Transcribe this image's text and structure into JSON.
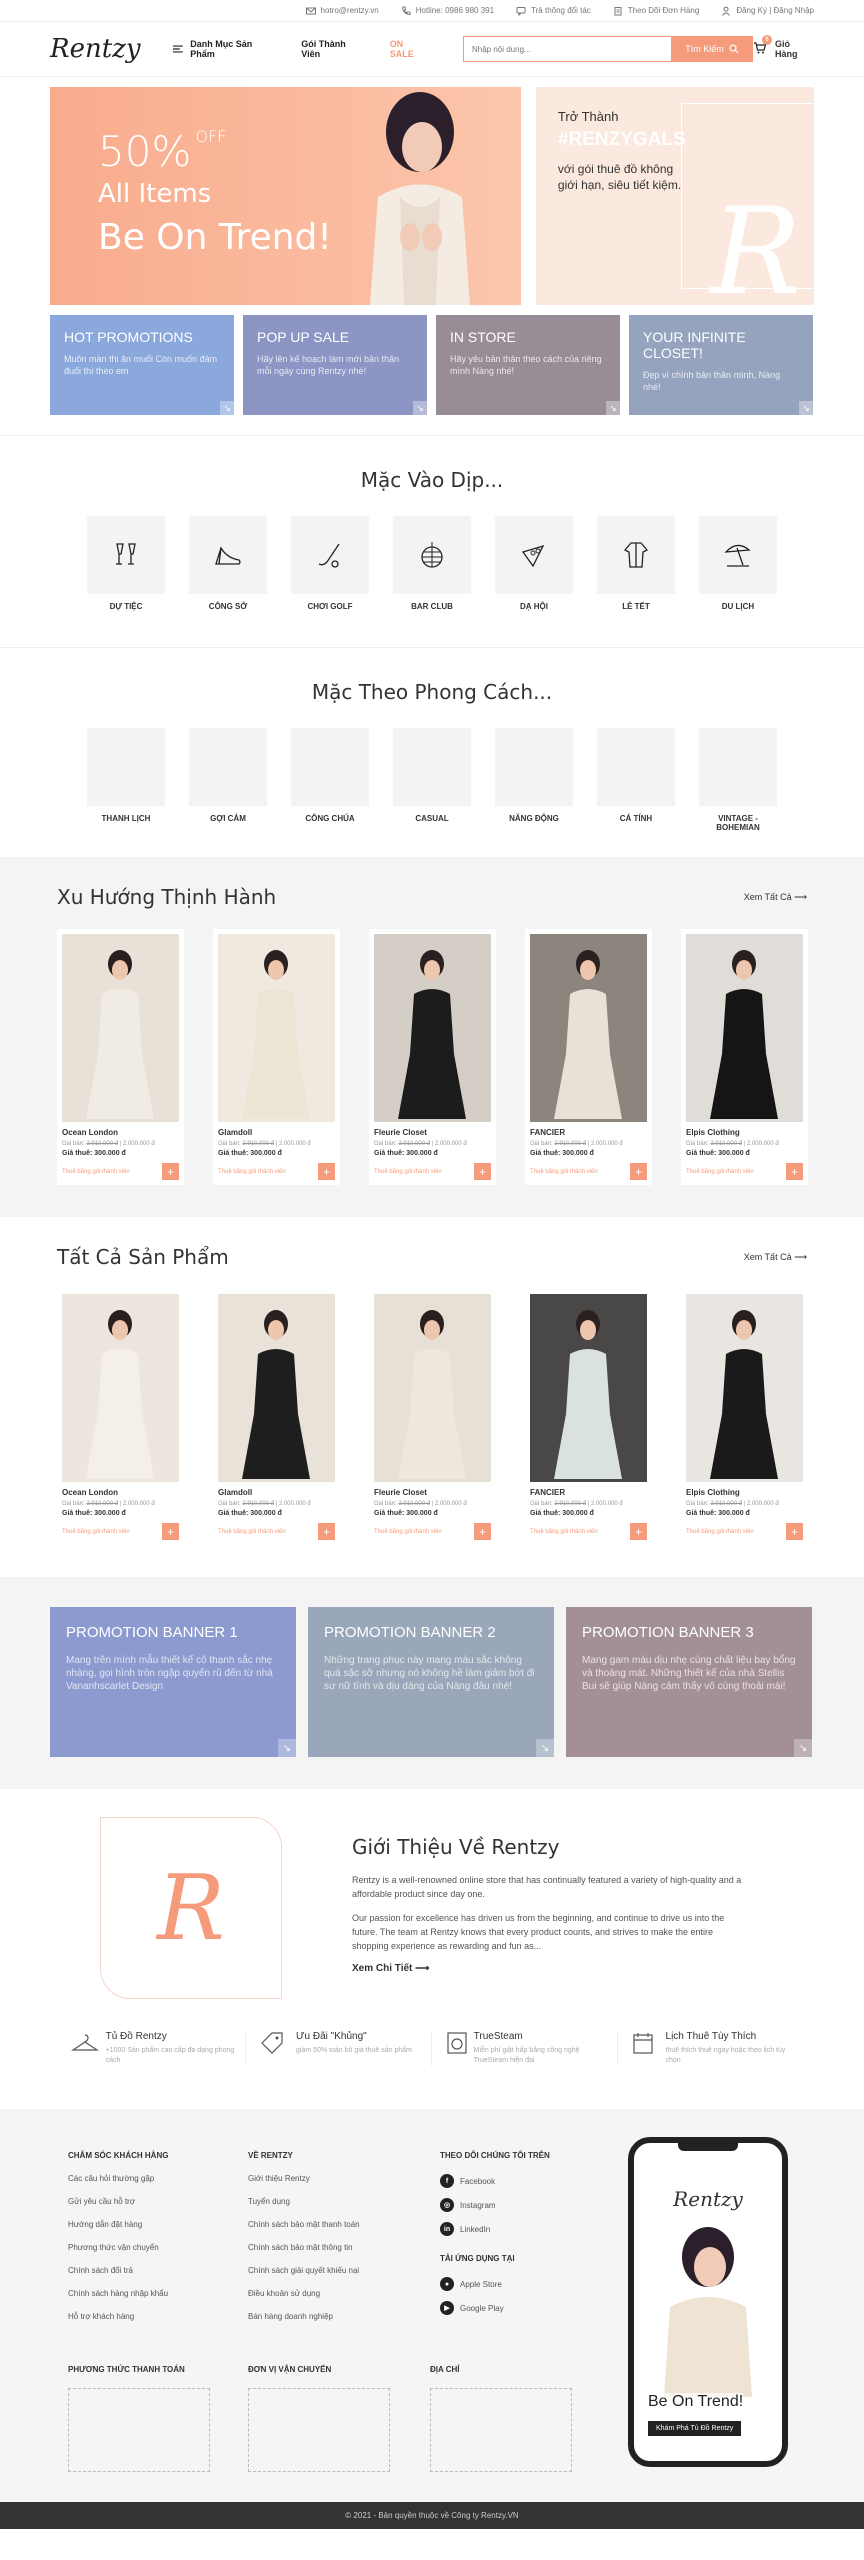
{
  "topbar": {
    "email": "hotro@rentzy.vn",
    "hotline": "Hotline: 0986 980 391",
    "shipping": "Trả thông đổi tác",
    "track": "Theo Dõi Đơn Hàng",
    "account": "Đăng Ký | Đăng Nhập"
  },
  "header": {
    "logo": "Rentzy",
    "nav_categories": "Danh Mục Sản Phẩm",
    "nav_member": "Gói Thành Viên",
    "nav_sale": "ON SALE",
    "search_placeholder": "Nhập nội dung...",
    "search_button": "Tìm Kiếm",
    "cart_label": "Giỏ Hàng",
    "cart_count": "0"
  },
  "hero": {
    "percent": "50%",
    "off": "OFF",
    "items": "All Items",
    "trend": "Be On Trend!",
    "side_line1": "Trở Thành",
    "side_tag": "#RENZYGALS",
    "side_desc": "với gói thuê đồ không giới hạn, siêu tiết kiệm.",
    "side_logo": "R"
  },
  "promos": [
    {
      "title": "HOT PROMOTIONS",
      "desc": "Muôn màn thi ăn muối Còn muốn đảm đuối thì theo em",
      "color": "#8ba8dc"
    },
    {
      "title": "POP UP SALE",
      "desc": "Hãy lên kế hoạch làm mới bản thân mỗi ngày cùng Rentzy nhé!",
      "color": "#8c95c4"
    },
    {
      "title": "IN STORE",
      "desc": "Hãy yêu bản thân theo cách của riêng mình Nàng nhé!",
      "color": "#988c97"
    },
    {
      "title": "YOUR INFINITE CLOSET!",
      "desc": "Đẹp vì chính bản thân mình, Nàng nhé!",
      "color": "#95a3bf"
    }
  ],
  "occasion": {
    "title": "Mặc Vào Dịp...",
    "items": [
      "DỰ TIỆC",
      "CÔNG SỞ",
      "CHƠI GOLF",
      "BAR CLUB",
      "DẠ HỘI",
      "LỄ TẾT",
      "DU LỊCH"
    ]
  },
  "style": {
    "title": "Mặc Theo Phong Cách...",
    "items": [
      "THANH LỊCH",
      "GỢI CẢM",
      "CÔNG CHÚA",
      "CASUAL",
      "NĂNG ĐỘNG",
      "CÁ TÍNH",
      "VINTAGE - BOHEMIAN"
    ]
  },
  "trending": {
    "title": "Xu Hướng Thịnh Hành",
    "view_all": "Xem Tất Cả",
    "products": [
      {
        "name": "Ocean London",
        "price_label": "Giá bán:",
        "old": "2.910.000 đ",
        "new": "2.000.000 đ",
        "rent": "Giá thuê: 300.000 đ",
        "member": "Thuê bằng gói thành viên"
      },
      {
        "name": "Glamdoll",
        "price_label": "Giá bán:",
        "old": "2.910.000 đ",
        "new": "2.000.000 đ",
        "rent": "Giá thuê: 300.000 đ",
        "member": "Thuê bằng gói thành viên"
      },
      {
        "name": "Fleurie Closet",
        "price_label": "Giá bán:",
        "old": "2.910.000 đ",
        "new": "2.000.000 đ",
        "rent": "Giá thuê: 300.000 đ",
        "member": "Thuê bằng gói thành viên"
      },
      {
        "name": "FANCIER",
        "price_label": "Giá bán:",
        "old": "2.910.000 đ",
        "new": "2.000.000 đ",
        "rent": "Giá thuê: 300.000 đ",
        "member": "Thuê bằng gói thành viên"
      },
      {
        "name": "Elpis Clothing",
        "price_label": "Giá bán:",
        "old": "2.910.000 đ",
        "new": "2.000.000 đ",
        "rent": "Giá thuê: 300.000 đ",
        "member": "Thuê bằng gói thành viên"
      }
    ]
  },
  "allproducts": {
    "title": "Tất Cả Sản Phẩm",
    "view_all": "Xem Tất Cả",
    "products": [
      {
        "name": "Ocean London",
        "price_label": "Giá bán:",
        "old": "2.910.000 đ",
        "new": "2.000.000 đ",
        "rent": "Giá thuê: 300.000 đ",
        "member": "Thuê bằng gói thành viên"
      },
      {
        "name": "Glamdoll",
        "price_label": "Giá bán:",
        "old": "2.910.000 đ",
        "new": "2.000.000 đ",
        "rent": "Giá thuê: 300.000 đ",
        "member": "Thuê bằng gói thành viên"
      },
      {
        "name": "Fleurie Closet",
        "price_label": "Giá bán:",
        "old": "2.910.000 đ",
        "new": "2.000.000 đ",
        "rent": "Giá thuê: 300.000 đ",
        "member": "Thuê bằng gói thành viên"
      },
      {
        "name": "FANCIER",
        "price_label": "Giá bán:",
        "old": "2.910.000 đ",
        "new": "2.000.000 đ",
        "rent": "Giá thuê: 300.000 đ",
        "member": "Thuê bằng gói thành viên"
      },
      {
        "name": "Elpis Clothing",
        "price_label": "Giá bán:",
        "old": "2.910.000 đ",
        "new": "2.000.000 đ",
        "rent": "Giá thuê: 300.000 đ",
        "member": "Thuê bằng gói thành viên"
      }
    ]
  },
  "banners": [
    {
      "title": "PROMOTION BANNER 1",
      "desc": "Mang trên mình mẫu thiết kế cô thanh sắc nhẹ nhàng, gọi hình tròn ngập quyến rũ đến từ nhà Vananhscarlet Design",
      "color": "#8c9ad0"
    },
    {
      "title": "PROMOTION BANNER 2",
      "desc": "Những trang phục này mang màu sắc không quá sặc sỡ nhưng nó không hề làm giảm bớt đi sự nữ tính và dịu dàng của Nàng đâu nhé!",
      "color": "#9aa6b9"
    },
    {
      "title": "PROMOTION BANNER 3",
      "desc": "Mang gam màu dịu nhẹ cùng chất liệu bay bổng và thoáng mát. Những thiết kế của nhà Stellis Bui sẽ giúp Nàng cảm thấy vô cùng thoải mái!",
      "color": "#a38f98"
    }
  ],
  "about": {
    "logo": "R",
    "title": "Giới Thiệu Về Rentzy",
    "p1": "Rentzy is a well-renowned online store that has continually featured a variety of high-quality and a affordable product since day one.",
    "p2": "Our passion for excellence has driven us from the beginning, and continue to drive us into the future. The team at Rentzy knows that every product counts, and strives to make the entire shopping experience as rewarding and fun as...",
    "more": "Xem Chi Tiết"
  },
  "features": [
    {
      "title": "Tủ Đồ Rentzy",
      "desc": "+1000 Sản phẩm cao cấp đa dạng phong cách"
    },
    {
      "title": "Ưu Đãi \"Khủng\"",
      "desc": "giảm 50% toàn bộ giá thuê sản phẩm"
    },
    {
      "title": "TrueSteam",
      "desc": "Miễn phí giặt hấp bằng công nghệ TrueSteam hiện đại"
    },
    {
      "title": "Lịch Thuê Tùy Thích",
      "desc": "thuê thích thuê ngay hoặc theo lịch tùy chọn"
    }
  ],
  "footer": {
    "care_title": "CHĂM SÓC KHÁCH HÀNG",
    "care": [
      "Các câu hỏi thường gặp",
      "Gửi yêu cầu hỗ trợ",
      "Hướng dẫn đặt hàng",
      "Phương thức vận chuyển",
      "Chính sách đổi trả",
      "Chính sách hàng nhập khẩu",
      "Hỗ trợ khách hàng"
    ],
    "about_title": "VỀ RENTZY",
    "about": [
      "Giới thiệu Rentzy",
      "Tuyển dụng",
      "Chính sách bảo mật thanh toán",
      "Chính sách bảo mật thông tin",
      "Chính sách giải quyết khiếu nại",
      "Điều khoản sử dụng",
      "Bán hàng doanh nghiệp"
    ],
    "follow_title": "THEO DÕI CHÚNG TÔI TRÊN",
    "follow": [
      "Facebook",
      "Instagram",
      "LinkedIn"
    ],
    "app_title": "TẢI ỨNG DỤNG TẠI",
    "apps": [
      "Apple Store",
      "Google Play"
    ],
    "pay_title": "PHƯƠNG THỨC THANH TOÁN",
    "ship_title": "ĐƠN VỊ VẬN CHUYỂN",
    "addr_title": "ĐỊA CHỈ",
    "copyright": "© 2021 - Bản quyền thuộc về Công ty Rentzy.VN",
    "phone_logo": "Rentzy",
    "phone_trend": "Be On Trend!",
    "phone_btn": "Khám Phá Tủ Đồ Rentzy"
  }
}
